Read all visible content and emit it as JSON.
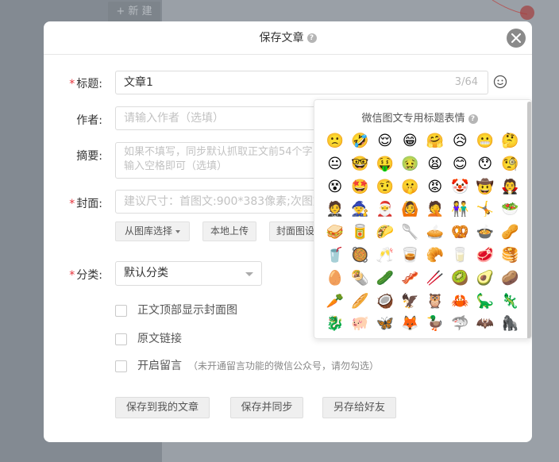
{
  "background": {
    "new_button_label": "+ 新 建"
  },
  "modal": {
    "title": "保存文章",
    "help_icon": "?",
    "close_icon": "×"
  },
  "form": {
    "title": {
      "label": "标题:",
      "required": "*",
      "value": "文章1",
      "counter": "3/64"
    },
    "author": {
      "label": "作者:",
      "placeholder": "请输入作者（选填）"
    },
    "summary": {
      "label": "摘要:",
      "placeholder": "如果不填写，同步默认抓取正文前54个字\n输入空格即可（选填）"
    },
    "cover": {
      "label": "封面:",
      "required": "*",
      "placeholder": "建议尺寸：首图文:900*383像素;次图文",
      "buttons": [
        "从图库选择",
        "本地上传",
        "封面图设"
      ]
    },
    "category": {
      "label": "分类:",
      "required": "*",
      "selected": "默认分类"
    },
    "checkboxes": [
      {
        "label": "正文顶部显示封面图",
        "note": ""
      },
      {
        "label": "原文链接",
        "note": ""
      },
      {
        "label": "开启留言",
        "note": "（未开通留言功能的微信公众号，请勿勾选）"
      }
    ],
    "actions": [
      "保存到我的文章",
      "保存并同步",
      "另存给好友"
    ]
  },
  "emoji_panel": {
    "title": "微信图文专用标题表情",
    "help_icon": "?",
    "emojis": [
      "🙁",
      "🤣",
      "😌",
      "😁",
      "🤗",
      "😥",
      "😬",
      "🤔",
      "😐",
      "🤓",
      "🤑",
      "🤢",
      "😫",
      "😊",
      "😯",
      "🧐",
      "😵",
      "🤩",
      "🤨",
      "🤫",
      "😡",
      "🤡",
      "🤠",
      "🧛",
      "🤵",
      "🧙",
      "🎅",
      "🙆",
      "🤦",
      "👫",
      "🤸",
      "🥗",
      "🥪",
      "🥫",
      "🌮",
      "🥄",
      "🥧",
      "🥨",
      "🍲",
      "🥜",
      "🥤",
      "🥘",
      "🥂",
      "🥃",
      "🥐",
      "🥛",
      "🥩",
      "🥞",
      "🥚",
      "🌯",
      "🥒",
      "🥓",
      "🥢",
      "🥝",
      "🥑",
      "🥔",
      "🥕",
      "🥖",
      "🥥",
      "🦅",
      "🦉",
      "🦀",
      "🦕",
      "🦎",
      "🐉",
      "🐖",
      "🦋",
      "🦊",
      "🦆",
      "🦈",
      "🦇",
      "🦍"
    ]
  },
  "colors": {
    "required": "#e5323a",
    "overlay": "#8e949b",
    "modal_bg": "#ffffff"
  }
}
